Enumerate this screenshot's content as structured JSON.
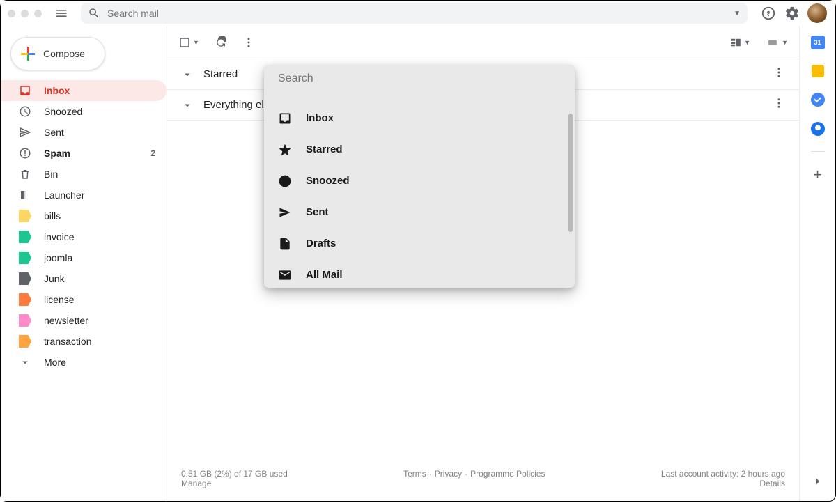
{
  "search": {
    "placeholder": "Search mail"
  },
  "compose": {
    "label": "Compose"
  },
  "sidebar": {
    "items": [
      {
        "label": "Inbox",
        "count": ""
      },
      {
        "label": "Snoozed",
        "count": ""
      },
      {
        "label": "Sent",
        "count": ""
      },
      {
        "label": "Spam",
        "count": "2"
      },
      {
        "label": "Bin",
        "count": ""
      },
      {
        "label": "Launcher",
        "count": ""
      }
    ],
    "labels": [
      {
        "label": "bills",
        "color": "#fdd663"
      },
      {
        "label": "invoice",
        "color": "#1dc691"
      },
      {
        "label": "joomla",
        "color": "#1dc691"
      },
      {
        "label": "Junk",
        "color": "#5f6368"
      },
      {
        "label": "license",
        "color": "#ff7b3d"
      },
      {
        "label": "newsletter",
        "color": "#ff8bcb"
      },
      {
        "label": "transaction",
        "color": "#ffa33f"
      }
    ],
    "more": "More"
  },
  "sections": [
    {
      "title": "Starred"
    },
    {
      "title": "Everything else"
    }
  ],
  "popup": {
    "placeholder": "Search",
    "items": [
      {
        "label": "Inbox"
      },
      {
        "label": "Starred"
      },
      {
        "label": "Snoozed"
      },
      {
        "label": "Sent"
      },
      {
        "label": "Drafts"
      },
      {
        "label": "All Mail"
      }
    ]
  },
  "footer": {
    "storage": "0.51 GB (2%) of 17 GB used",
    "manage": "Manage",
    "terms": "Terms",
    "privacy": "Privacy",
    "policies": "Programme Policies",
    "activity": "Last account activity: 2 hours ago",
    "details": "Details"
  }
}
